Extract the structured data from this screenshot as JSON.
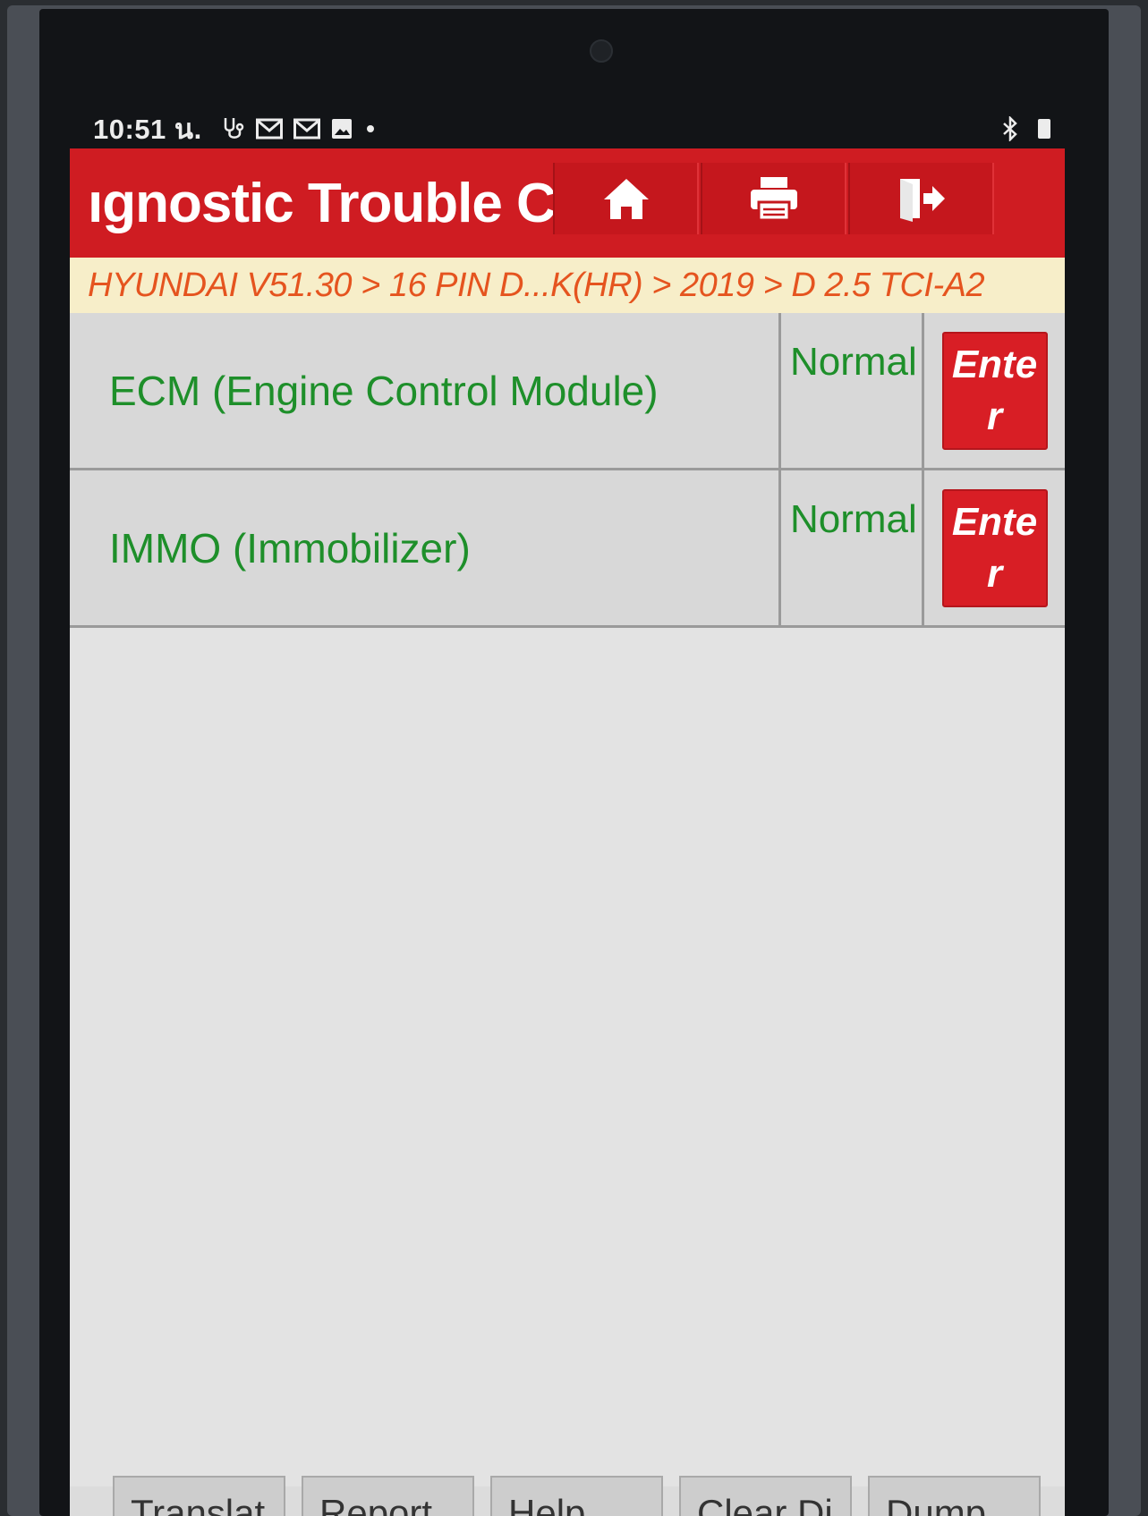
{
  "status_bar": {
    "time": "10:51 น.",
    "icons": [
      "stethoscope-icon",
      "gmail-icon",
      "gmail-icon",
      "image-icon"
    ],
    "right_icons": [
      "bluetooth-icon",
      "battery-icon"
    ]
  },
  "header": {
    "title": "ıgnostic Trouble Cc",
    "buttons": [
      "home-icon",
      "print-icon",
      "exit-icon"
    ]
  },
  "breadcrumb": "HYUNDAI V51.30 > 16 PIN D...K(HR) > 2019 > D 2.5 TCI-A2",
  "rows": [
    {
      "name": "ECM (Engine Control Module)",
      "status": "Normal",
      "action": "Enter"
    },
    {
      "name": "IMMO (Immobilizer)",
      "status": "Normal",
      "action": "Enter"
    }
  ],
  "bottom_buttons": [
    "Translat",
    "Report",
    "Help",
    "Clear Di",
    "Dump"
  ],
  "colors": {
    "title_bar": "#cf1c22",
    "breadcrumb_bg": "#f7eec9",
    "breadcrumb_text": "#e5541f",
    "row_text": "#1e8f2a",
    "enter_button": "#d81e25"
  }
}
